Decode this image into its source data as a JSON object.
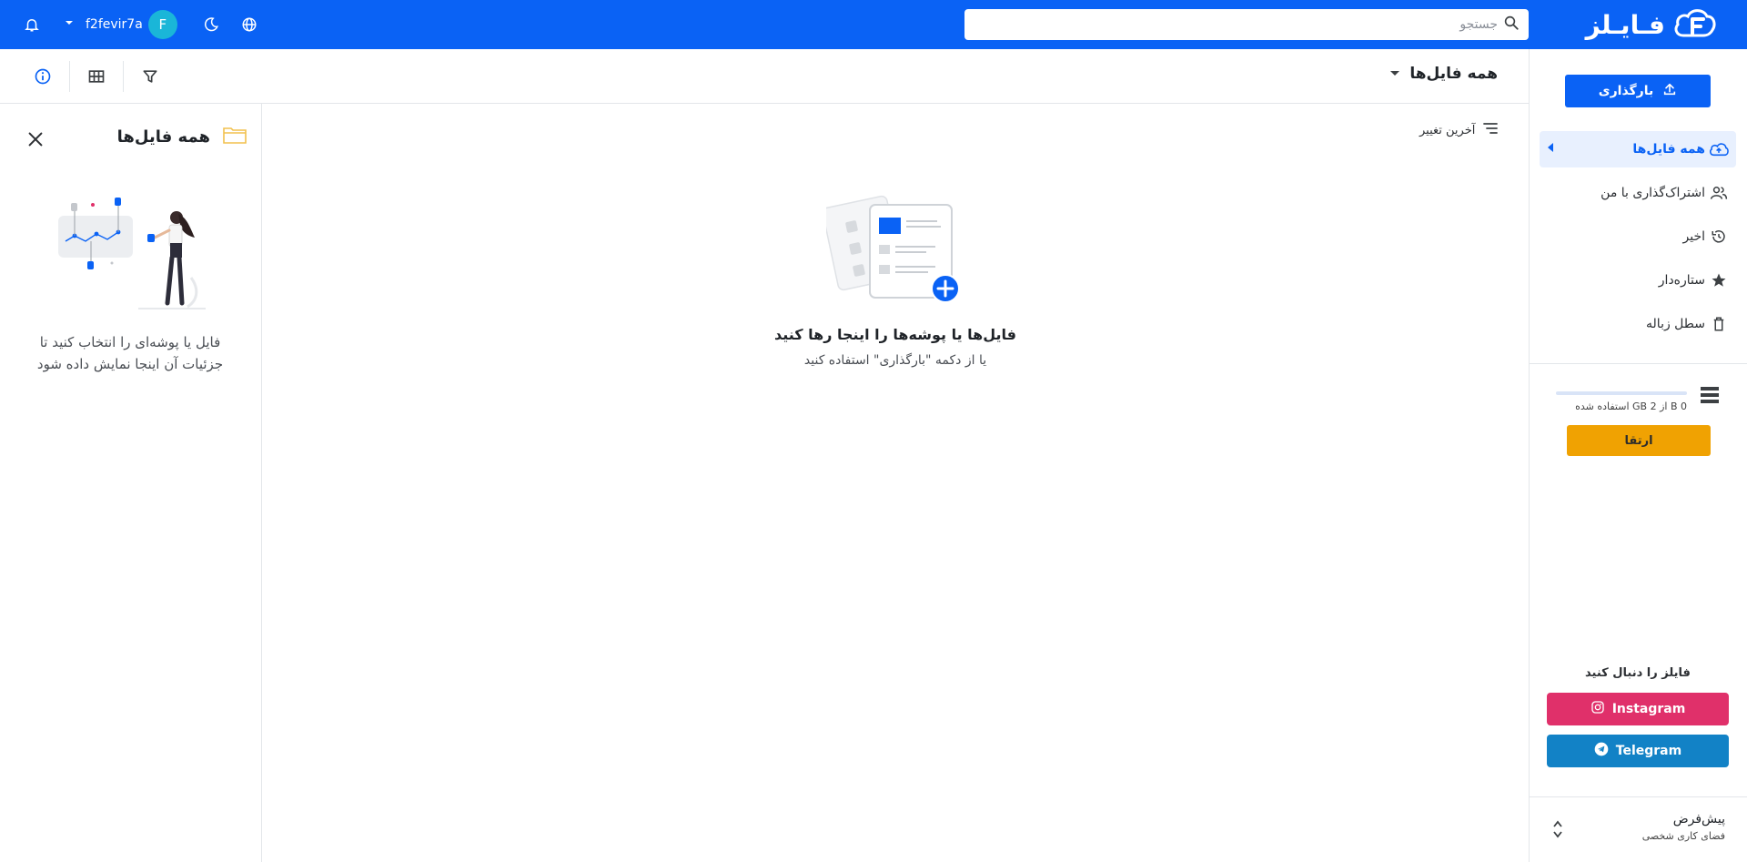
{
  "header": {
    "brand": "فـایـلز",
    "search_placeholder": "جستجو",
    "username": "f2fevir7a",
    "avatar_letter": "F"
  },
  "sidebar": {
    "upload_label": "بارگذاری",
    "items": [
      {
        "label": "همه فایل‌ها",
        "icon": "cloud-upload-icon",
        "active": true
      },
      {
        "label": "اشتراک‌گذاری با من",
        "icon": "people-icon"
      },
      {
        "label": "اخیر",
        "icon": "history-icon"
      },
      {
        "label": "ستاره‌دار",
        "icon": "star-icon"
      },
      {
        "label": "سطل زباله",
        "icon": "trash-icon"
      }
    ],
    "storage": {
      "text": "0 B از 2 GB استفاده شده",
      "used_fraction": 0
    },
    "upgrade_label": "ارتقا",
    "follow_title": "فایلز را دنبال کنید",
    "instagram_label": "Instagram",
    "telegram_label": "Telegram",
    "workspace": {
      "name": "پیش‌فرض",
      "subtitle": "فضای کاری شخصی"
    }
  },
  "toolbar": {
    "breadcrumb": "همه فایل‌ها"
  },
  "details": {
    "title": "همه فایل‌ها",
    "message": "فایل یا پوشه‌ای را انتخاب کنید تا جزئیات آن اینجا نمایش داده شود"
  },
  "content": {
    "sort_label": "آخرین تغییر",
    "empty_title": "فایل‌ها یا پوشه‌ها را اینجا رها کنید",
    "empty_subtitle": "یا از دکمه \"بارگذاری\" استفاده کنید"
  },
  "colors": {
    "primary": "#0a62f5",
    "upgrade": "#f0a202",
    "instagram": "#e0306a",
    "telegram": "#1282c6"
  }
}
